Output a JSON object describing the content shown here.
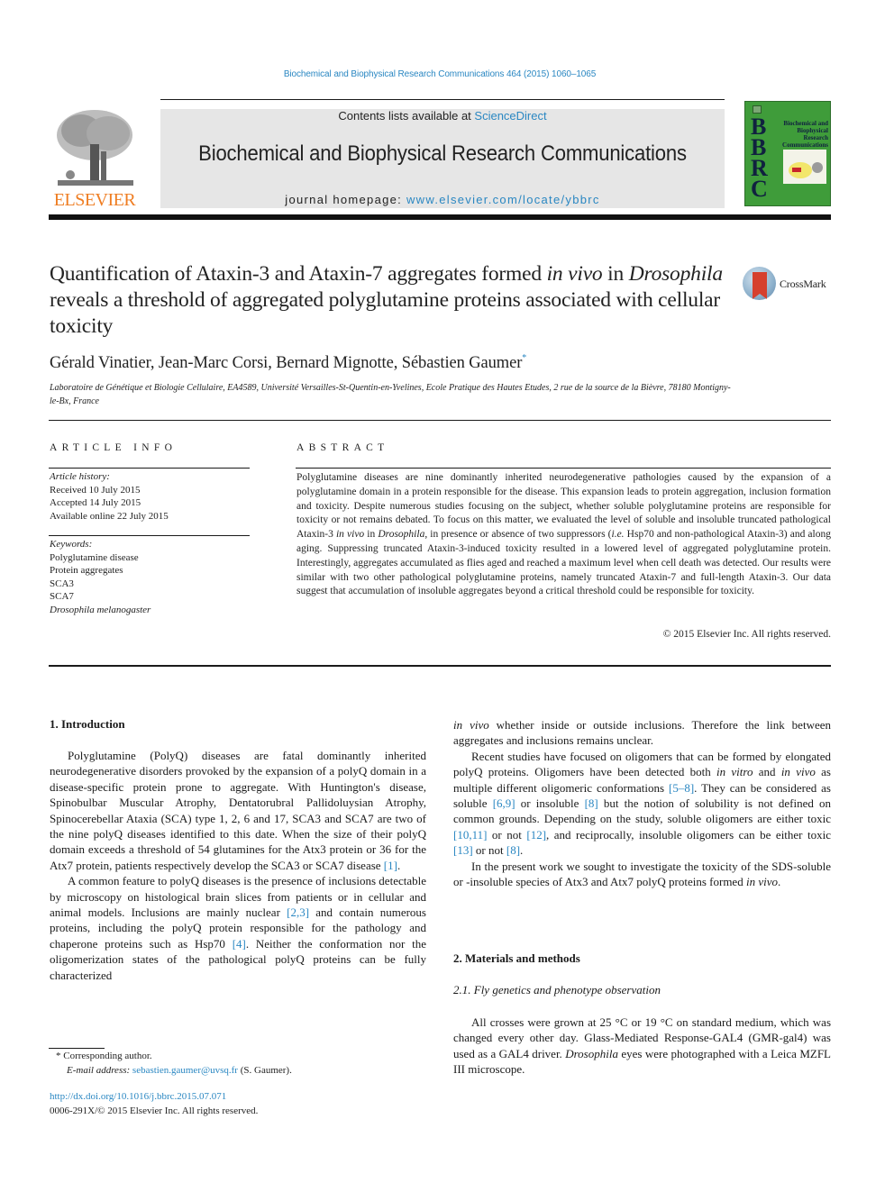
{
  "header": {
    "citation": "Biochemical and Biophysical Research Communications 464 (2015) 1060–1065",
    "contents_prefix": "Contents lists available at ",
    "contents_link": "ScienceDirect",
    "journal_title": "Biochemical and Biophysical Research Communications",
    "homepage_prefix": "journal homepage: ",
    "homepage_link": "www.elsevier.com/locate/ybbrc",
    "publisher_logo_text": "ELSEVIER",
    "cover": {
      "letters": [
        "B",
        "B",
        "R",
        "C"
      ],
      "title_lines": [
        "Biochemical and",
        "Biophysical",
        "Research",
        "Communications"
      ]
    },
    "colors": {
      "link": "#2a87c2",
      "elsevier_orange": "#ef7d22",
      "cover_green": "#3f9c3a",
      "banner_gray": "#e6e6e6"
    }
  },
  "article": {
    "title_part1": "Quantification of Ataxin-3 and Ataxin-7 aggregates formed ",
    "title_italic1": "in vivo",
    "title_part2": " in ",
    "title_italic2": "Drosophila",
    "title_part3": " reveals a threshold of aggregated polyglutamine proteins associated with cellular toxicity",
    "crossmark_label": "CrossMark",
    "authors": "Gérald Vinatier, Jean-Marc Corsi, Bernard Mignotte, Sébastien Gaumer",
    "author_mark": "*",
    "affiliation": "Laboratoire de Génétique et Biologie Cellulaire, EA4589, Université Versailles-St-Quentin-en-Yvelines, Ecole Pratique des Hautes Etudes, 2 rue de la source de la Bièvre, 78180 Montigny-le-Bx, France"
  },
  "article_info": {
    "heading": "ARTICLE INFO",
    "history_label": "Article history:",
    "history": [
      "Received 10 July 2015",
      "Accepted 14 July 2015",
      "Available online 22 July 2015"
    ],
    "keywords_label": "Keywords:",
    "keywords": [
      "Polyglutamine disease",
      "Protein aggregates",
      "SCA3",
      "SCA7",
      "Drosophila melanogaster"
    ]
  },
  "abstract": {
    "heading": "ABSTRACT",
    "text_a": "Polyglutamine diseases are nine dominantly inherited neurodegenerative pathologies caused by the expansion of a polyglutamine domain in a protein responsible for the disease. This expansion leads to protein aggregation, inclusion formation and toxicity. Despite numerous studies focusing on the subject, whether soluble polyglutamine proteins are responsible for toxicity or not remains debated. To focus on this matter, we evaluated the level of soluble and insoluble truncated pathological Ataxin-3 ",
    "text_italic_a": "in vivo",
    "text_b": " in ",
    "text_italic_b": "Drosophila",
    "text_c": ", in presence or absence of two suppressors (",
    "text_italic_c": "i.e.",
    "text_d": " Hsp70 and non-pathological Ataxin-3) and along aging. Suppressing truncated Ataxin-3-induced toxicity resulted in a lowered level of aggregated polyglutamine protein. Interestingly, aggregates accumulated as flies aged and reached a maximum level when cell death was detected. Our results were similar with two other pathological polyglutamine proteins, namely truncated Ataxin-7 and full-length Ataxin-3. Our data suggest that accumulation of insoluble aggregates beyond a critical threshold could be responsible for toxicity.",
    "copyright": "© 2015 Elsevier Inc. All rights reserved."
  },
  "body": {
    "intro_heading": "1.  Introduction",
    "intro_p1_a": "Polyglutamine (PolyQ) diseases are fatal dominantly inherited neurodegenerative disorders provoked by the expansion of a polyQ domain in a disease-specific protein prone to aggregate. With Huntington's disease, Spinobulbar Muscular Atrophy, Dentatorubral Pallidoluysian Atrophy, Spinocerebellar Ataxia (SCA) type 1, 2, 6 and 17, SCA3 and SCA7 are two of the nine polyQ diseases identified to this date. When the size of their polyQ domain exceeds a threshold of 54 glutamines for the Atx3 protein or 36 for the Atx7 protein, patients respectively develop the SCA3 or SCA7 disease ",
    "intro_p1_ref": "[1]",
    "intro_p1_end": ".",
    "intro_p2_a": "A common feature to polyQ diseases is the presence of inclusions detectable by microscopy on histological brain slices from patients or in cellular and animal models. Inclusions are mainly nuclear ",
    "intro_p2_ref1": "[2,3]",
    "intro_p2_b": " and contain numerous proteins, including the polyQ protein responsible for the pathology and chaperone proteins such as Hsp70 ",
    "intro_p2_ref2": "[4]",
    "intro_p2_c": ". Neither the conformation nor the oligomerization states of the pathological polyQ proteins can be fully characterized ",
    "right_p1_italic": "in vivo",
    "right_p1": " whether inside or outside inclusions. Therefore the link between aggregates and inclusions remains unclear.",
    "right_p2_a": "Recent studies have focused on oligomers that can be formed by elongated polyQ proteins. Oligomers have been detected both ",
    "right_p2_i1": "in vitro",
    "right_p2_and": " and ",
    "right_p2_i2": "in vivo",
    "right_p2_b": " as multiple different oligomeric conformations ",
    "right_p2_ref1": "[5–8]",
    "right_p2_c": ". They can be considered as soluble ",
    "right_p2_ref2": "[6,9]",
    "right_p2_d": " or insoluble ",
    "right_p2_ref3": "[8]",
    "right_p2_e": " but the notion of solubility is not defined on common grounds. Depending on the study, soluble oligomers are either toxic ",
    "right_p2_ref4": "[10,11]",
    "right_p2_f": " or not ",
    "right_p2_ref5": "[12]",
    "right_p2_g": ", and reciprocally, insoluble oligomers can be either toxic ",
    "right_p2_ref6": "[13]",
    "right_p2_h": " or not ",
    "right_p2_ref7": "[8]",
    "right_p2_end": ".",
    "right_p3_a": "In the present work we sought to investigate the toxicity of the SDS-soluble or -insoluble species of Atx3 and Atx7 polyQ proteins formed ",
    "right_p3_i": "in vivo",
    "right_p3_end": ".",
    "mm_heading": "2.  Materials and methods",
    "fly_heading": "2.1.  Fly genetics and phenotype observation",
    "fly_p1_a": "All crosses were grown at 25 °C or 19 °C on standard medium, which was changed every other day. Glass-Mediated Response-GAL4 (GMR-gal4) was used as a GAL4 driver. ",
    "fly_p1_i": "Drosophila",
    "fly_p1_b": " eyes were photographed with a Leica MZFL III microscope."
  },
  "footnote": {
    "mark": "*",
    "corresponding": "Corresponding author.",
    "email_label": "E-mail address:",
    "email": "sebastien.gaumer@uvsq.fr",
    "email_suffix": " (S. Gaumer).",
    "doi": "http://dx.doi.org/10.1016/j.bbrc.2015.07.071",
    "issn_line": "0006-291X/© 2015 Elsevier Inc. All rights reserved."
  }
}
